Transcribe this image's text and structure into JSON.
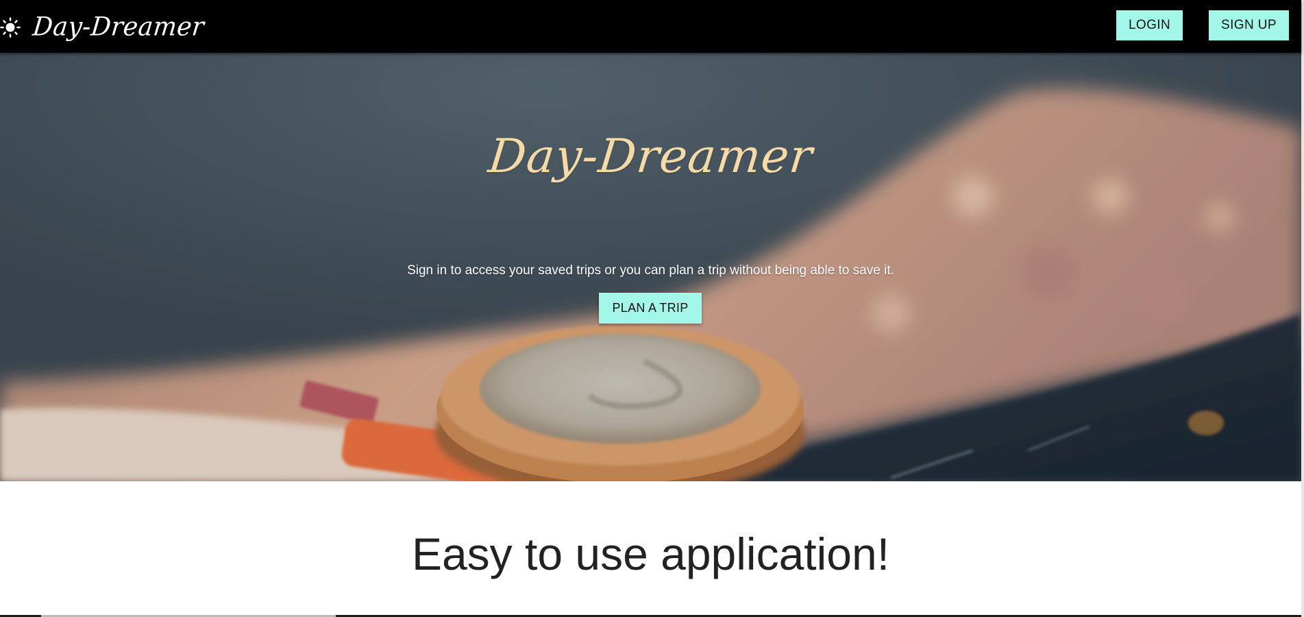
{
  "navbar": {
    "brand_name": "Day-Dreamer",
    "brand_icon": "sun-icon",
    "login_label": "LOGIN",
    "signup_label": "SIGN UP"
  },
  "hero": {
    "title": "Day-Dreamer",
    "subtitle": "Sign in to access your saved trips or you can plan a trip without being able to save it.",
    "plan_button_label": "PLAN A TRIP"
  },
  "features": {
    "heading": "Easy to use application!"
  },
  "colors": {
    "navbar_bg": "#000000",
    "button_accent": "#a3f7e8",
    "hero_title": "#f5d9a6",
    "heading_text": "#222222"
  }
}
